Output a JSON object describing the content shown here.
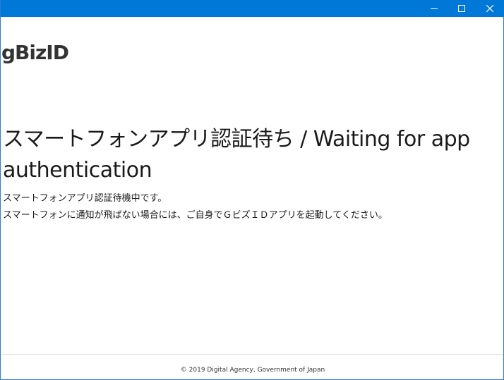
{
  "window": {
    "controls": {
      "minimize": "minimize",
      "maximize": "maximize",
      "close": "close"
    },
    "accent_color": "#0078d7"
  },
  "header": {
    "logo_text": "gBizID"
  },
  "main": {
    "title": "スマートフォンアプリ認証待ち / Waiting for app authentication",
    "line1": "スマートフォンアプリ認証待機中です。",
    "line2": "スマートフォンに通知が飛ばない場合には、ご自身でＧビズＩＤアプリを起動してください。"
  },
  "footer": {
    "copyright": "© 2019 Digital Agency, Government of Japan"
  }
}
